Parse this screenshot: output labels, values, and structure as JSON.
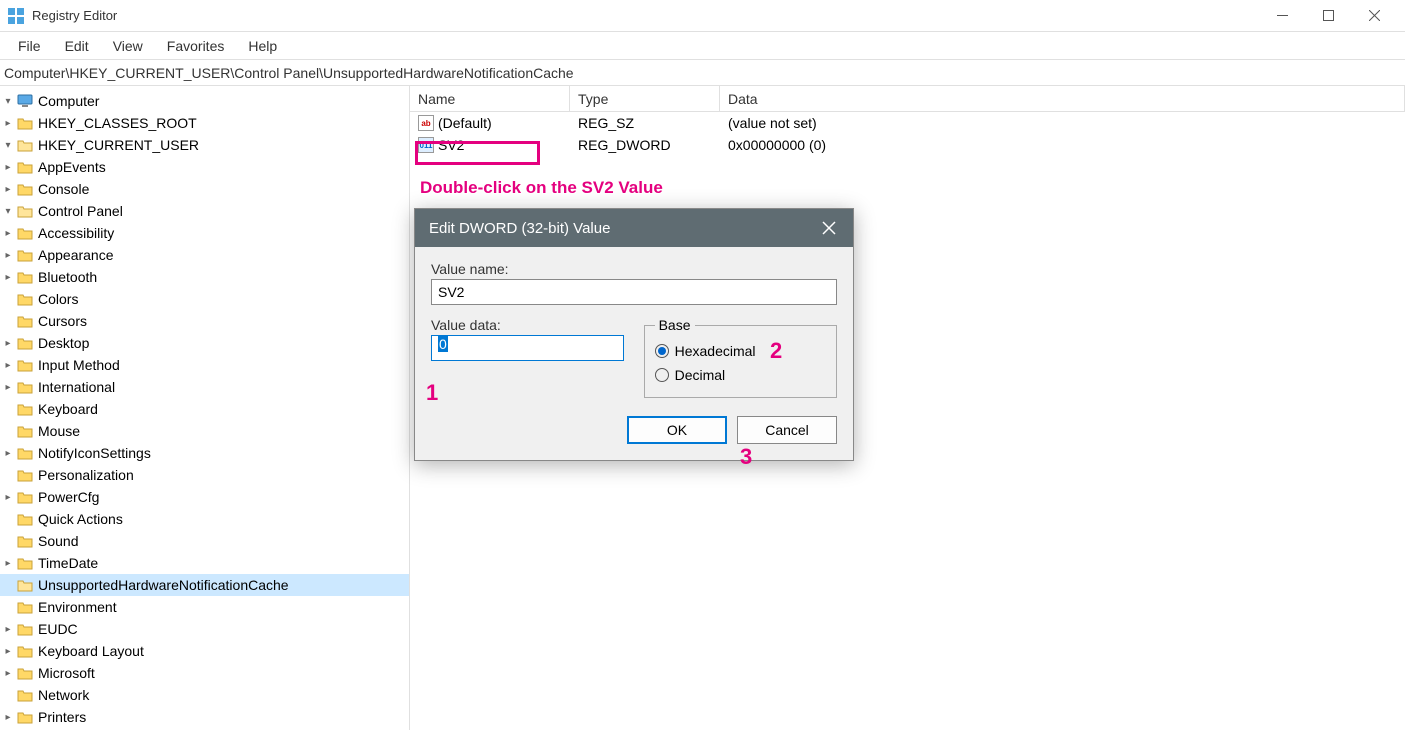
{
  "window": {
    "title": "Registry Editor"
  },
  "menu": {
    "file": "File",
    "edit": "Edit",
    "view": "View",
    "favorites": "Favorites",
    "help": "Help"
  },
  "address": "Computer\\HKEY_CURRENT_USER\\Control Panel\\UnsupportedHardwareNotificationCache",
  "tree": {
    "root": "Computer",
    "hkcr": "HKEY_CLASSES_ROOT",
    "hkcu": "HKEY_CURRENT_USER",
    "hkcu_children": {
      "appevents": "AppEvents",
      "console": "Console",
      "controlpanel": "Control Panel",
      "cp_children": {
        "accessibility": "Accessibility",
        "appearance": "Appearance",
        "bluetooth": "Bluetooth",
        "colors": "Colors",
        "cursors": "Cursors",
        "desktop": "Desktop",
        "inputmethod": "Input Method",
        "international": "International",
        "keyboard": "Keyboard",
        "mouse": "Mouse",
        "notifyicon": "NotifyIconSettings",
        "personalization": "Personalization",
        "powercfg": "PowerCfg",
        "quickactions": "Quick Actions",
        "sound": "Sound",
        "timedate": "TimeDate",
        "uhnc": "UnsupportedHardwareNotificationCache"
      },
      "environment": "Environment",
      "eudc": "EUDC",
      "keyboardlayout": "Keyboard Layout",
      "microsoft": "Microsoft",
      "network": "Network",
      "printers": "Printers"
    }
  },
  "list": {
    "headers": {
      "name": "Name",
      "type": "Type",
      "data": "Data"
    },
    "rows": [
      {
        "name": "(Default)",
        "type": "REG_SZ",
        "data": "(value not set)",
        "icon": "sz"
      },
      {
        "name": "SV2",
        "type": "REG_DWORD",
        "data": "0x00000000 (0)",
        "icon": "dw"
      }
    ]
  },
  "annotations": {
    "instruction": "Double-click on the SV2 Value",
    "num1": "1",
    "num2": "2",
    "num3": "3"
  },
  "dialog": {
    "title": "Edit DWORD (32-bit) Value",
    "value_name_label": "Value name:",
    "value_name": "SV2",
    "value_data_label": "Value data:",
    "value_data": "0",
    "base_label": "Base",
    "hex": "Hexadecimal",
    "dec": "Decimal",
    "ok": "OK",
    "cancel": "Cancel"
  }
}
